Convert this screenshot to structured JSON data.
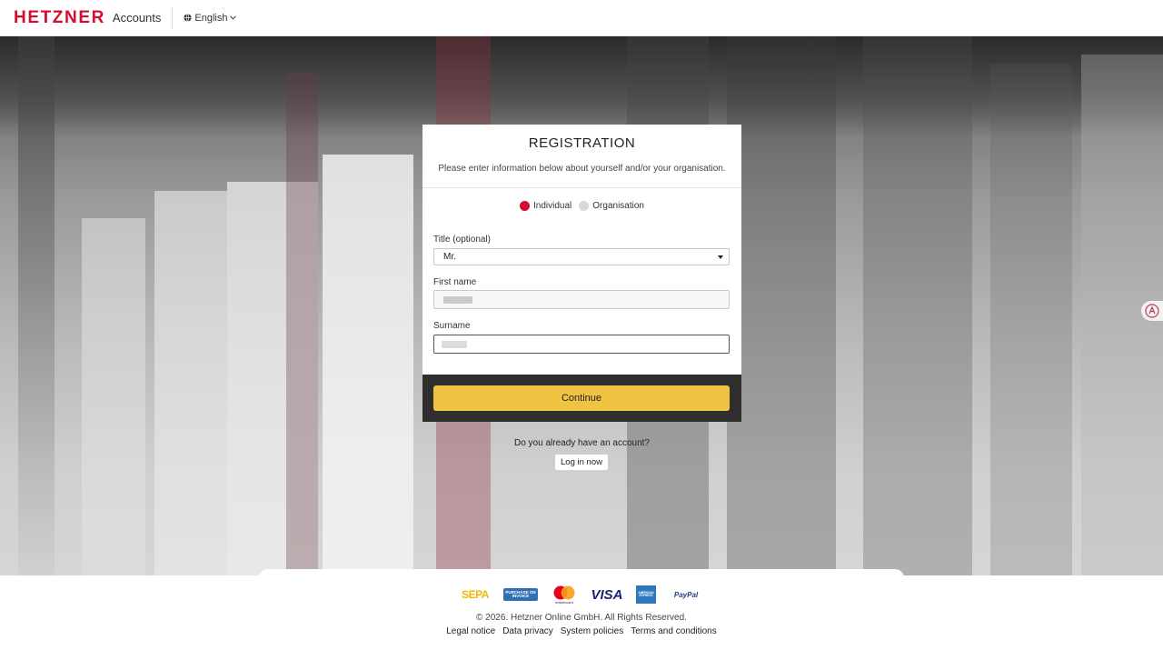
{
  "header": {
    "logo_text": "HETZNER",
    "app_name": "Accounts",
    "language": "English"
  },
  "registration": {
    "title": "REGISTRATION",
    "subtitle": "Please enter information below about yourself and/or your organisation.",
    "account_type": {
      "options": [
        "Individual",
        "Organisation"
      ],
      "selected": "Individual"
    },
    "title_field": {
      "label": "Title (optional)",
      "value": "Mr."
    },
    "first_name": {
      "label": "First name"
    },
    "surname": {
      "label": "Surname"
    },
    "continue_label": "Continue"
  },
  "login": {
    "prompt": "Do you already have an account?",
    "button_label": "Log in now"
  },
  "footer": {
    "payment_methods": [
      "SEPA",
      "PURCHASE ON INVOICE",
      "mastercard",
      "VISA",
      "AMERICAN EXPRESS",
      "PayPal"
    ],
    "copyright": "© 2026. Hetzner Online GmbH. All Rights Reserved.",
    "links": [
      "Legal notice",
      "Data privacy",
      "System policies",
      "Terms and conditions"
    ]
  },
  "colors": {
    "brand_red": "#d50c2d",
    "continue_yellow": "#f0c443",
    "strip_dark": "#2f2f2f"
  }
}
